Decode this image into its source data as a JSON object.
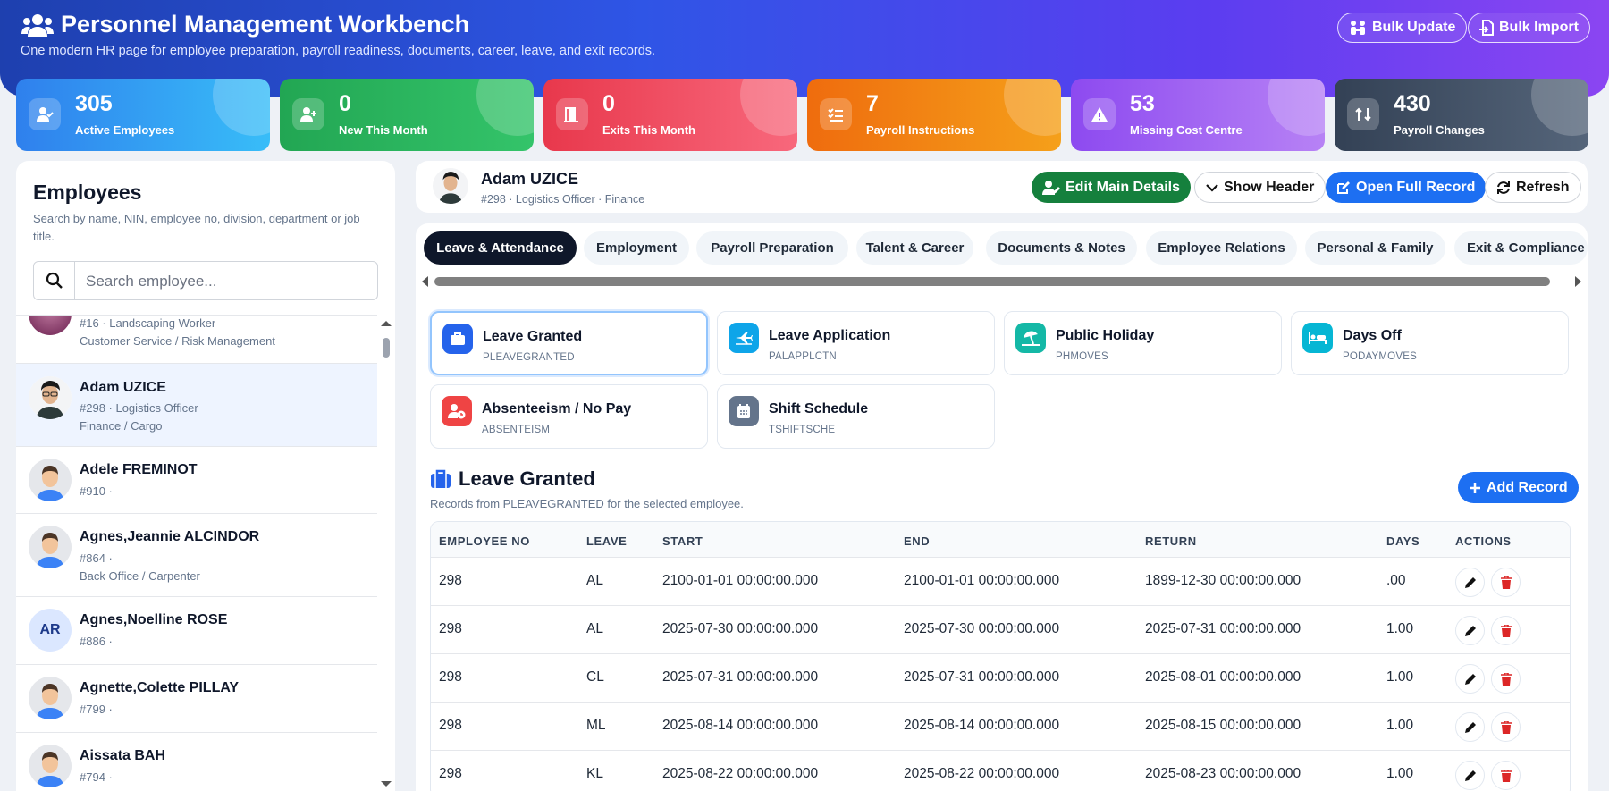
{
  "header": {
    "title": "Personnel Management Workbench",
    "subtitle": "One modern HR page for employee preparation, payroll readiness, documents, career, leave, and exit records.",
    "bulk_update": "Bulk Update",
    "bulk_import": "Bulk Import"
  },
  "kpis": [
    {
      "value": "305",
      "label": "Active Employees",
      "icon": "user-check-icon",
      "color": "#2f80ed"
    },
    {
      "value": "0",
      "label": "New This Month",
      "icon": "user-plus-icon",
      "color": "#22b35e"
    },
    {
      "value": "0",
      "label": "Exits This Month",
      "icon": "door-exit-icon",
      "color": "#ef3d55"
    },
    {
      "value": "7",
      "label": "Payroll Instructions",
      "icon": "list-check-icon",
      "color": "#f47a12"
    },
    {
      "value": "53",
      "label": "Missing Cost Centre",
      "icon": "warning-icon",
      "color": "#9b51f0"
    },
    {
      "value": "430",
      "label": "Payroll Changes",
      "icon": "swap-icon",
      "color": "#3b4a60"
    }
  ],
  "employees_panel": {
    "title": "Employees",
    "subtitle": "Search by name, NIN, employee no, division, department or job title.",
    "search_placeholder": "Search employee...",
    "items": [
      {
        "line1": "#16 · Landscaping Worker",
        "line2": "Customer Service / Risk Management",
        "avatar": "photo-purple"
      },
      {
        "name": "Adam UZICE",
        "line1": "#298 · Logistics Officer",
        "line2": "Finance / Cargo",
        "avatar": "photo-man"
      },
      {
        "name": "Adele FREMINOT",
        "line1": "#910 ·",
        "avatar": "default"
      },
      {
        "name": "Agnes,Jeannie ALCINDOR",
        "line1": "#864 ·",
        "line2": "Back Office / Carpenter",
        "avatar": "default"
      },
      {
        "name": "Agnes,Noelline ROSE",
        "line1": "#886 ·",
        "initials": "AR",
        "avatar": "initials"
      },
      {
        "name": "Agnette,Colette PILLAY",
        "line1": "#799 ·",
        "avatar": "default"
      },
      {
        "name": "Aissata BAH",
        "line1": "#794 ·",
        "avatar": "default"
      }
    ]
  },
  "selected": {
    "name": "Adam UZICE",
    "meta": "#298 · Logistics Officer · Finance",
    "edit_main": "Edit Main Details",
    "show_header": "Show Header",
    "open_full": "Open Full Record",
    "refresh": "Refresh"
  },
  "tabs": [
    "Leave & Attendance",
    "Employment",
    "Payroll Preparation",
    "Talent & Career",
    "Documents & Notes",
    "Employee Relations",
    "Personal & Family",
    "Exit & Compliance"
  ],
  "modules": [
    {
      "title": "Leave Granted",
      "code": "PLEAVEGRANTED",
      "color": "#2563eb",
      "icon": "suitcase-icon"
    },
    {
      "title": "Leave Application",
      "code": "PALAPPLCTN",
      "color": "#0ea5e9",
      "icon": "plane-icon"
    },
    {
      "title": "Public Holiday",
      "code": "PHMOVES",
      "color": "#14b8a6",
      "icon": "umbrella-beach-icon"
    },
    {
      "title": "Days Off",
      "code": "PODAYMOVES",
      "color": "#06b6d4",
      "icon": "bed-icon"
    },
    {
      "title": "Absenteeism / No Pay",
      "code": "ABSENTEISM",
      "color": "#ef4444",
      "icon": "user-clock-icon"
    },
    {
      "title": "Shift Schedule",
      "code": "TSHIFTSCHE",
      "color": "#64748b",
      "icon": "calendar-icon"
    }
  ],
  "section": {
    "title": "Leave Granted",
    "subtitle": "Records from PLEAVEGRANTED for the selected employee.",
    "add_record": "Add Record"
  },
  "table": {
    "columns": [
      "EMPLOYEE NO",
      "LEAVE",
      "START",
      "END",
      "RETURN",
      "DAYS",
      "ACTIONS"
    ],
    "rows": [
      [
        "298",
        "AL",
        "2100-01-01 00:00:00.000",
        "2100-01-01 00:00:00.000",
        "1899-12-30 00:00:00.000",
        ".00"
      ],
      [
        "298",
        "AL",
        "2025-07-30 00:00:00.000",
        "2025-07-30 00:00:00.000",
        "2025-07-31 00:00:00.000",
        "1.00"
      ],
      [
        "298",
        "CL",
        "2025-07-31 00:00:00.000",
        "2025-07-31 00:00:00.000",
        "2025-08-01 00:00:00.000",
        "1.00"
      ],
      [
        "298",
        "ML",
        "2025-08-14 00:00:00.000",
        "2025-08-14 00:00:00.000",
        "2025-08-15 00:00:00.000",
        "1.00"
      ],
      [
        "298",
        "KL",
        "2025-08-22 00:00:00.000",
        "2025-08-22 00:00:00.000",
        "2025-08-23 00:00:00.000",
        "1.00"
      ]
    ]
  }
}
